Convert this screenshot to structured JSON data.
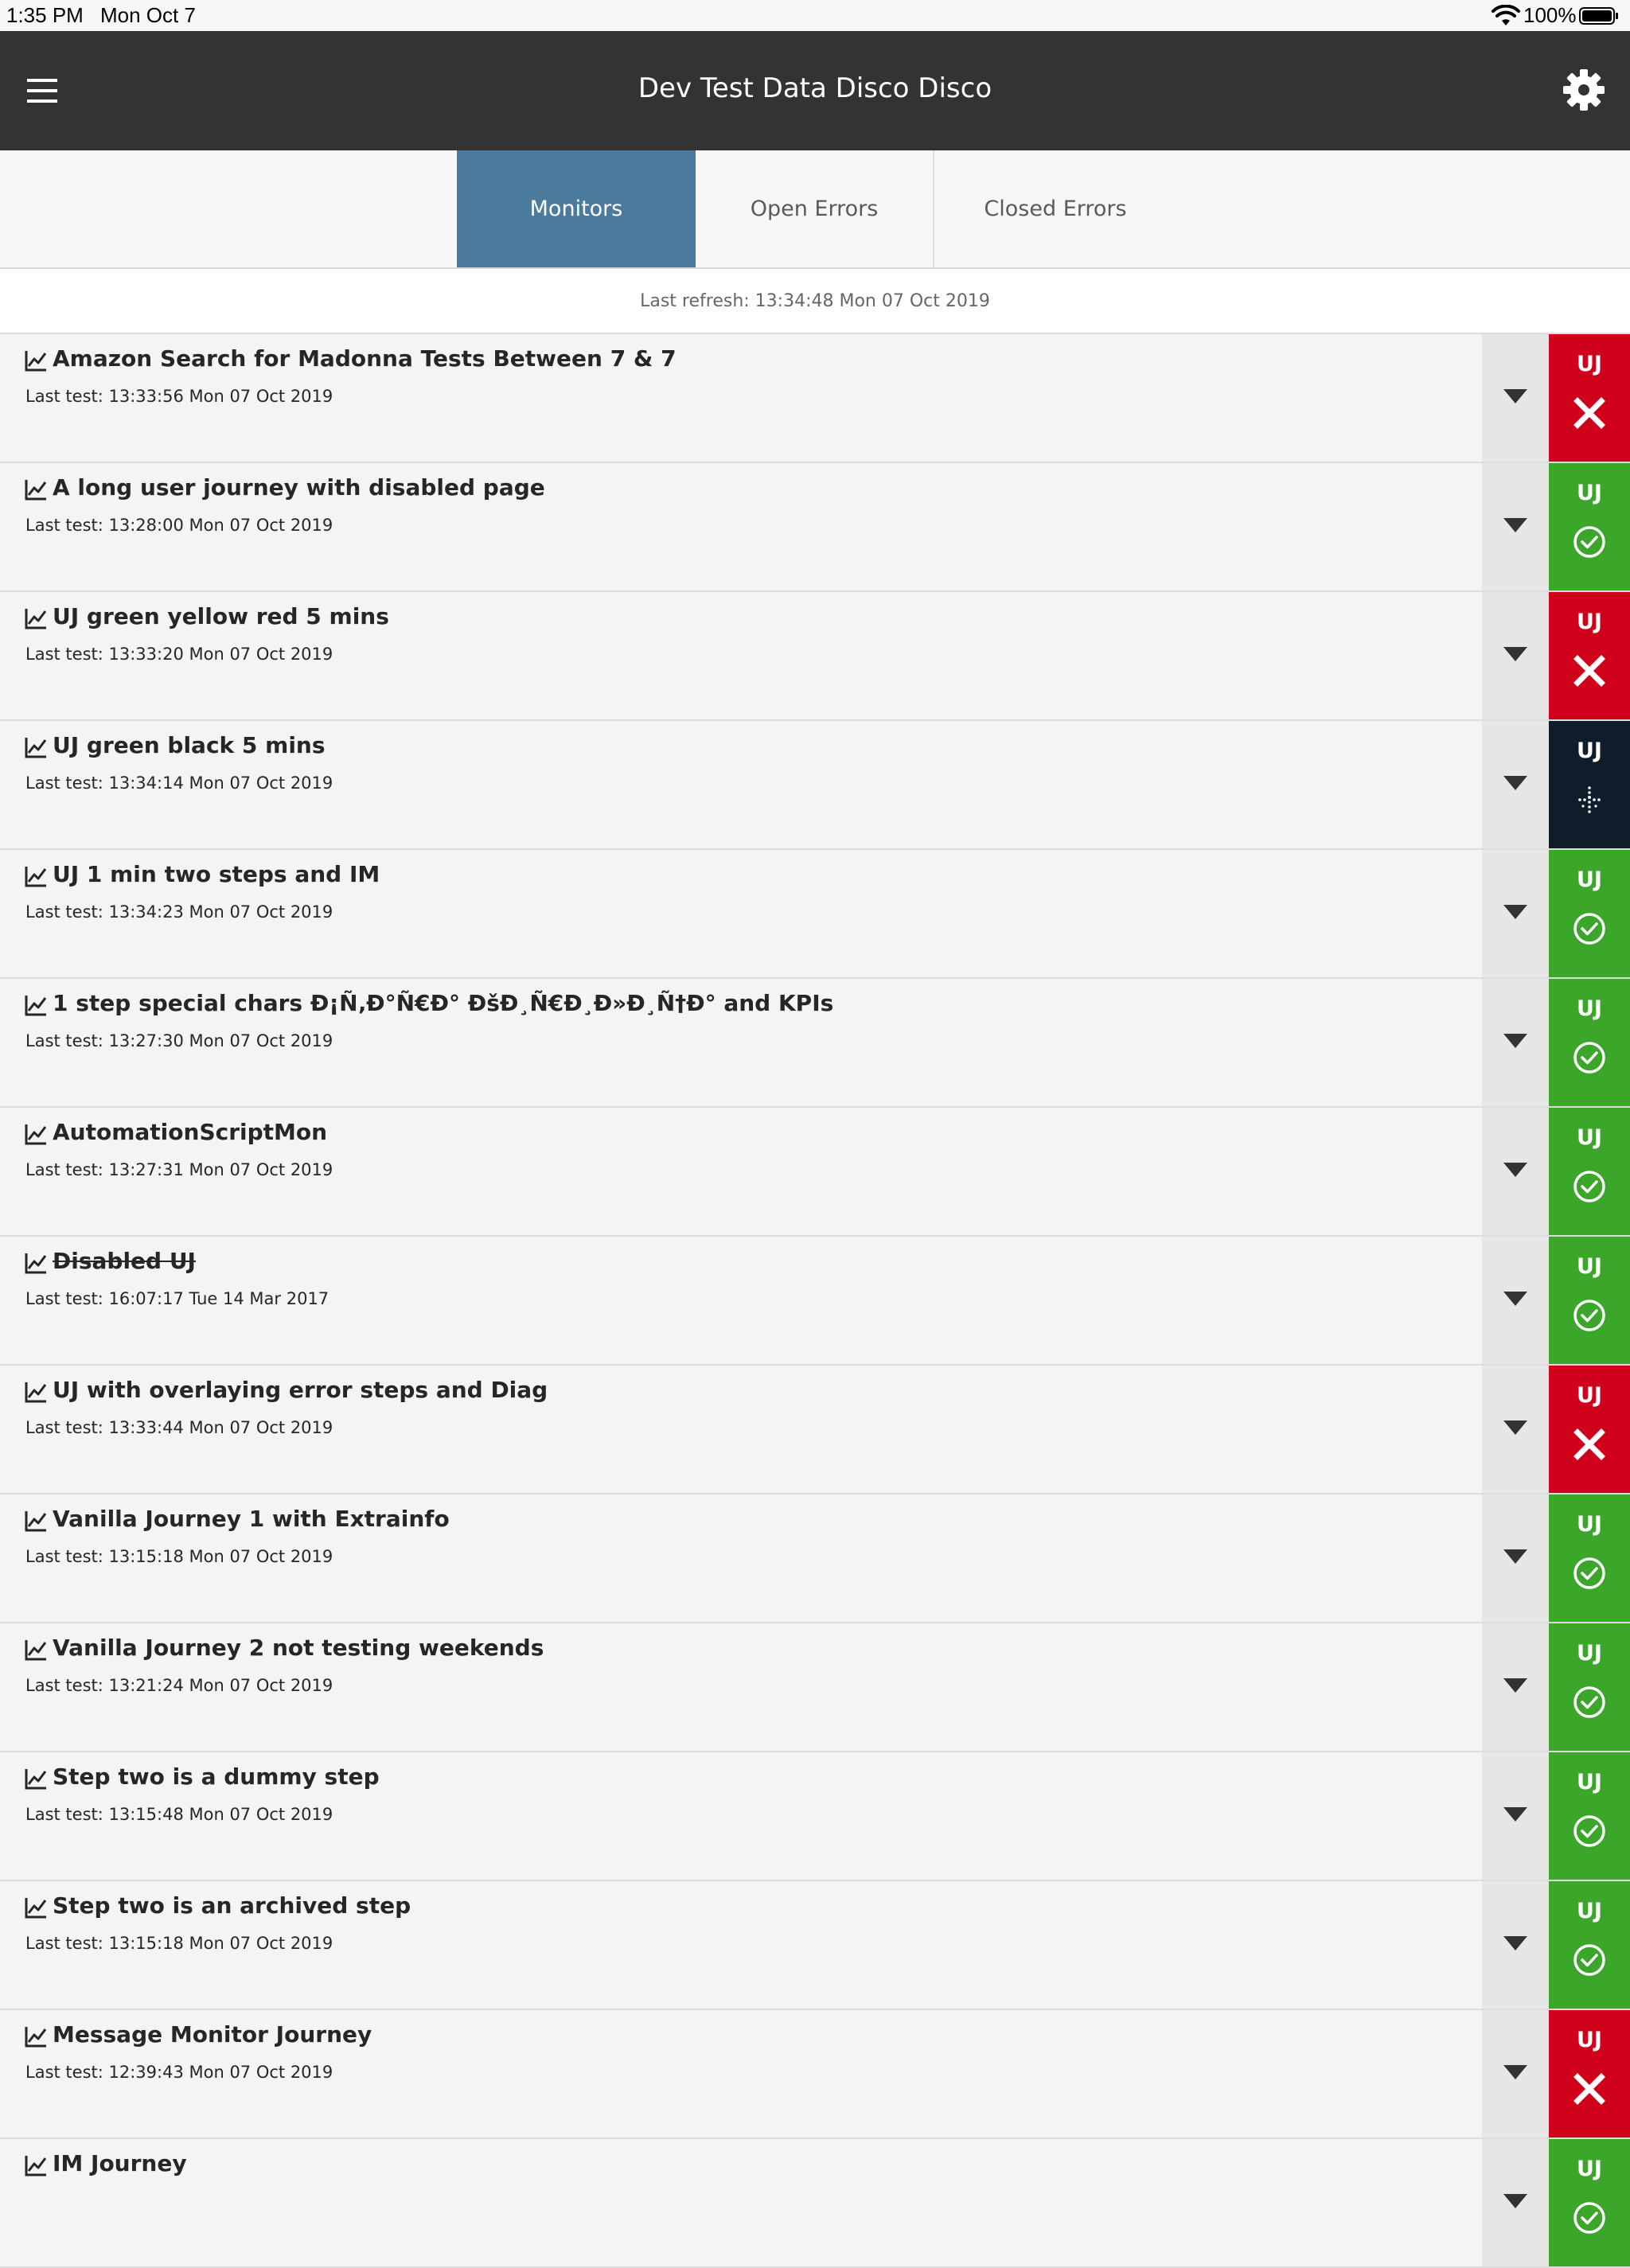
{
  "status_bar": {
    "time": "1:35 PM",
    "date": "Mon Oct 7",
    "battery": "100%"
  },
  "header": {
    "title": "Dev Test Data Disco Disco",
    "menu_icon": "hamburger-menu-icon",
    "settings_icon": "gear-icon"
  },
  "tabs": [
    {
      "label": "Monitors",
      "active": true
    },
    {
      "label": "Open Errors",
      "active": false
    },
    {
      "label": "Closed Errors",
      "active": false
    }
  ],
  "last_refresh": "Last refresh: 13:34:48 Mon 07 Oct 2019",
  "colors": {
    "header": "#333333",
    "tab_active": "#4a7b9d",
    "fail": "#d0021b",
    "ok": "#3ca62b",
    "running": "#0f1c2a"
  },
  "monitors": [
    {
      "name": "Amazon Search for Madonna Tests Between 7 & 7",
      "last_test": "Last test: 13:33:56 Mon 07 Oct 2019",
      "type": "UJ",
      "status": "fail",
      "disabled": false
    },
    {
      "name": "A long user journey with disabled page",
      "last_test": "Last test: 13:28:00 Mon 07 Oct 2019",
      "type": "UJ",
      "status": "ok",
      "disabled": false
    },
    {
      "name": "UJ green yellow red 5 mins",
      "last_test": "Last test: 13:33:20 Mon 07 Oct 2019",
      "type": "UJ",
      "status": "fail",
      "disabled": false
    },
    {
      "name": "UJ green black 5 mins",
      "last_test": "Last test: 13:34:14 Mon 07 Oct 2019",
      "type": "UJ",
      "status": "running",
      "disabled": false
    },
    {
      "name": "UJ 1 min two steps and IM",
      "last_test": "Last test: 13:34:23 Mon 07 Oct 2019",
      "type": "UJ",
      "status": "ok",
      "disabled": false
    },
    {
      "name": "1 step special chars Đ¡Ñ‚Đ°Ñ€Đ° ĐšĐ¸Ñ€Đ¸Đ»Đ¸Ñ†Đ° and KPIs",
      "last_test": "Last test: 13:27:30 Mon 07 Oct 2019",
      "type": "UJ",
      "status": "ok",
      "disabled": false
    },
    {
      "name": "AutomationScriptMon",
      "last_test": "Last test: 13:27:31 Mon 07 Oct 2019",
      "type": "UJ",
      "status": "ok",
      "disabled": false
    },
    {
      "name": "Disabled UJ",
      "last_test": "Last test: 16:07:17 Tue 14 Mar 2017",
      "type": "UJ",
      "status": "ok",
      "disabled": true
    },
    {
      "name": "UJ with overlaying error steps and Diag",
      "last_test": "Last test: 13:33:44 Mon 07 Oct 2019",
      "type": "UJ",
      "status": "fail",
      "disabled": false
    },
    {
      "name": "Vanilla Journey 1 with Extrainfo",
      "last_test": "Last test: 13:15:18 Mon 07 Oct 2019",
      "type": "UJ",
      "status": "ok",
      "disabled": false
    },
    {
      "name": "Vanilla Journey 2 not testing weekends",
      "last_test": "Last test: 13:21:24 Mon 07 Oct 2019",
      "type": "UJ",
      "status": "ok",
      "disabled": false
    },
    {
      "name": "Step two is a dummy step",
      "last_test": "Last test: 13:15:48 Mon 07 Oct 2019",
      "type": "UJ",
      "status": "ok",
      "disabled": false
    },
    {
      "name": "Step two is an archived step",
      "last_test": "Last test: 13:15:18 Mon 07 Oct 2019",
      "type": "UJ",
      "status": "ok",
      "disabled": false
    },
    {
      "name": "Message Monitor Journey",
      "last_test": "Last test: 12:39:43 Mon 07 Oct 2019",
      "type": "UJ",
      "status": "fail",
      "disabled": false
    },
    {
      "name": "IM Journey",
      "last_test": "",
      "type": "UJ",
      "status": "ok",
      "disabled": false
    }
  ]
}
